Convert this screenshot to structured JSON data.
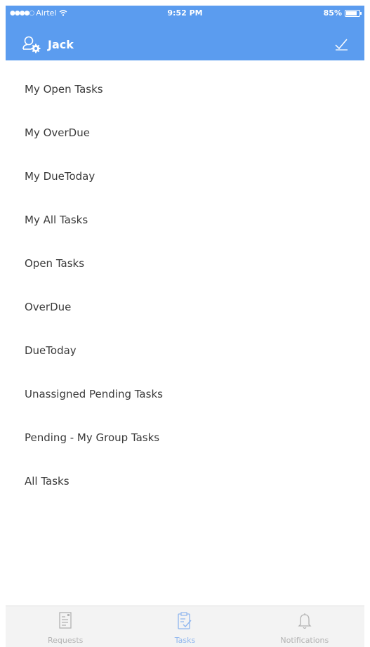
{
  "status_bar": {
    "carrier": "Airtel",
    "time": "9:52 PM",
    "battery": "85%",
    "battery_level": 0.85
  },
  "header": {
    "username": "Jack"
  },
  "menu": {
    "items": [
      {
        "label": "My Open Tasks"
      },
      {
        "label": "My OverDue"
      },
      {
        "label": "My DueToday"
      },
      {
        "label": "My All Tasks"
      },
      {
        "label": "Open Tasks"
      },
      {
        "label": "OverDue"
      },
      {
        "label": "DueToday"
      },
      {
        "label": "Unassigned Pending Tasks"
      },
      {
        "label": "Pending - My Group Tasks"
      },
      {
        "label": "All Tasks"
      }
    ]
  },
  "tab_bar": {
    "tabs": [
      {
        "label": "Requests",
        "icon": "document-icon",
        "active": false
      },
      {
        "label": "Tasks",
        "icon": "clipboard-check-icon",
        "active": true
      },
      {
        "label": "Notifications",
        "icon": "bell-icon",
        "active": false
      }
    ]
  },
  "colors": {
    "header": "#5b9cef",
    "tab_active": "#8fb6ee",
    "tab_inactive": "#b2b2b2"
  }
}
